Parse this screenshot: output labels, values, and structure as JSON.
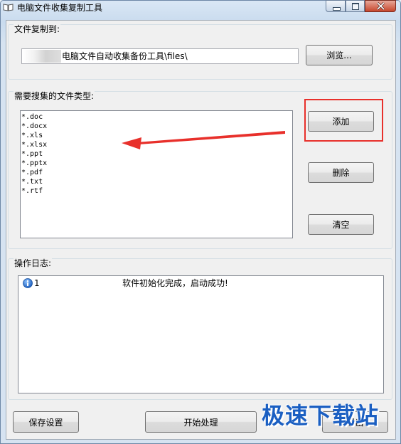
{
  "window": {
    "title": "电脑文件收集复制工具",
    "icon": "book-icon"
  },
  "copy_to": {
    "label": "文件复制到:",
    "path_value": "电脑文件自动收集备份工具\\files\\",
    "browse_label": "浏览..."
  },
  "file_types": {
    "label": "需要搜集的文件类型:",
    "items": [
      "*.doc",
      "*.docx",
      "*.xls",
      "*.xlsx",
      "*.ppt",
      "*.pptx",
      "*.pdf",
      "*.txt",
      "*.rtf"
    ],
    "add_label": "添加",
    "delete_label": "删除",
    "clear_label": "清空"
  },
  "log": {
    "label": "操作日志:",
    "rows": [
      {
        "id": "1",
        "message": "软件初始化完成，启动成功!"
      }
    ]
  },
  "bottom": {
    "save_label": "保存设置",
    "start_label": "开始处理",
    "exit_label": "退出"
  },
  "watermark": "极速下载站",
  "colors": {
    "highlight": "#e8302b",
    "arrow": "#e8302b",
    "watermark": "#1b5fc2",
    "title_bar": "#c9dbee"
  }
}
